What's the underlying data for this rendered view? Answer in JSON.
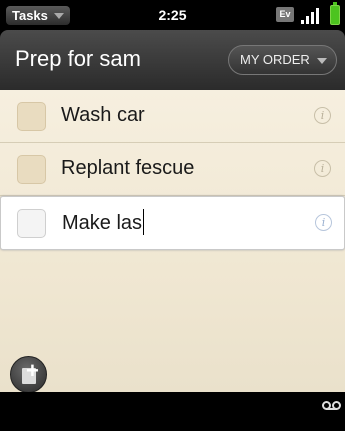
{
  "status_bar": {
    "app_menu_label": "Tasks",
    "time": "2:25",
    "network_badge": "Ev"
  },
  "header": {
    "list_title": "Prep for sam",
    "sort_label": "MY ORDER"
  },
  "tasks": [
    {
      "label": "Wash car",
      "checked": false
    },
    {
      "label": "Replant fescue",
      "checked": false
    },
    {
      "label": "Make las",
      "checked": false,
      "editing": true
    }
  ],
  "icons": {
    "info": "info-icon",
    "add": "add-task-icon",
    "voicemail": "voicemail-icon"
  },
  "colors": {
    "paper": "#f3ebd8",
    "header": "#3a3a3a",
    "battery": "#4cc41f"
  }
}
